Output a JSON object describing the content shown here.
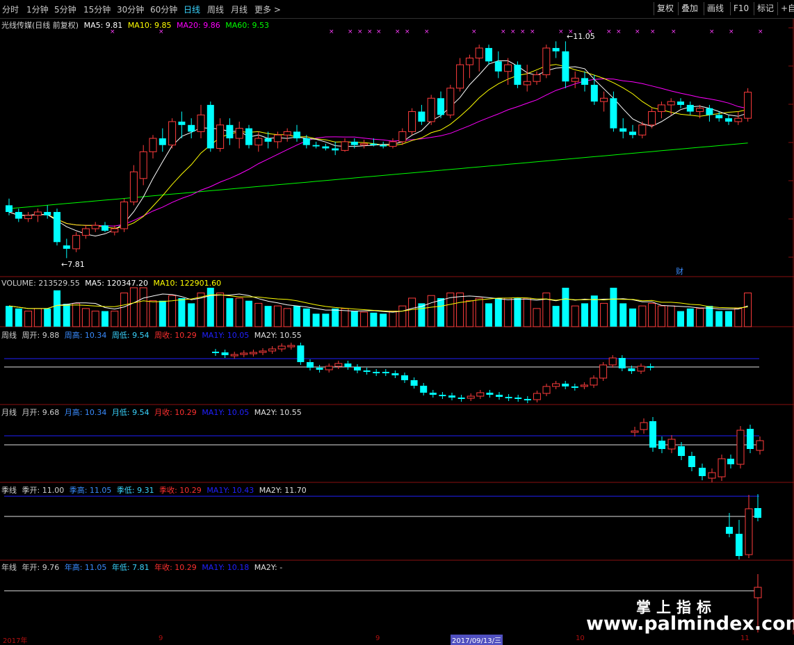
{
  "toolbar": {
    "timeframes": [
      "分时",
      "1分钟",
      "5分钟",
      "15分钟",
      "30分钟",
      "60分钟",
      "日线",
      "周线",
      "月线",
      "更多 >"
    ],
    "active_timeframe": "日线",
    "right_buttons": [
      "复权",
      "叠加",
      "画线",
      "F10",
      "标记",
      "+自选"
    ]
  },
  "main_panel": {
    "stock_title": "光线传媒(日线 前复权)",
    "ma5": "MA5: 9.81",
    "ma10": "MA10: 9.85",
    "ma20": "MA20: 9.86",
    "ma60": "MA60: 9.53",
    "high_marker": "11.05",
    "low_marker": "7.81",
    "finance_marker": "财"
  },
  "volume_panel": {
    "volume": "VOLUME: 213529.55",
    "ma5": "MA5: 120347.20",
    "ma10": "MA10: 122901.60"
  },
  "week_panel": {
    "name": "周线",
    "open": "周开: 9.88",
    "high": "周高: 10.34",
    "low": "周低: 9.54",
    "close": "周收: 10.29",
    "ma1y": "MA1Y: 10.05",
    "ma2y": "MA2Y: 10.55"
  },
  "month_panel": {
    "name": "月线",
    "open": "月开: 9.68",
    "high": "月高: 10.34",
    "low": "月低: 9.54",
    "close": "月收: 10.29",
    "ma1y": "MA1Y: 10.05",
    "ma2y": "MA2Y: 10.55"
  },
  "season_panel": {
    "name": "季线",
    "open": "季开: 11.00",
    "high": "季高: 11.05",
    "low": "季低: 9.31",
    "close": "季收: 10.29",
    "ma1y": "MA1Y: 10.43",
    "ma2y": "MA2Y: 11.70"
  },
  "year_panel": {
    "name": "年线",
    "open": "年开: 9.76",
    "high": "年高: 11.05",
    "low": "年低: 7.81",
    "close": "年收: 10.29",
    "ma1y": "MA1Y: 10.18",
    "ma2y": "MA2Y: -"
  },
  "date_axis": {
    "labels": [
      "2017年",
      "9",
      "9",
      "2017/09/13/三",
      "10",
      "11"
    ]
  },
  "watermark": {
    "cn": "掌上指标",
    "url": "www.palmindex.com"
  },
  "colors": {
    "up": "#ff3c3c",
    "down": "#00ffff",
    "ma5": "#ffffff",
    "ma10": "#ffff00",
    "ma20": "#ff00ff",
    "ma60": "#00ff00",
    "active_tab": "#3ad5ff",
    "separator": "#8a1010"
  },
  "chart_data": {
    "type": "candlestick",
    "title": "光线传媒(日线 前复权)",
    "candles_ohlc": [
      [
        8.6,
        8.7,
        8.45,
        8.5
      ],
      [
        8.5,
        8.55,
        8.35,
        8.4
      ],
      [
        8.4,
        8.5,
        8.35,
        8.45
      ],
      [
        8.45,
        8.55,
        8.35,
        8.5
      ],
      [
        8.5,
        8.6,
        8.4,
        8.45
      ],
      [
        8.5,
        8.55,
        8.0,
        8.05
      ],
      [
        8.0,
        8.1,
        7.81,
        7.95
      ],
      [
        7.95,
        8.2,
        7.9,
        8.15
      ],
      [
        8.15,
        8.3,
        8.1,
        8.25
      ],
      [
        8.25,
        8.35,
        8.2,
        8.3
      ],
      [
        8.3,
        8.35,
        8.2,
        8.22
      ],
      [
        8.2,
        8.3,
        8.15,
        8.25
      ],
      [
        8.25,
        8.7,
        8.2,
        8.65
      ],
      [
        8.65,
        9.2,
        8.6,
        9.1
      ],
      [
        9.0,
        9.5,
        8.9,
        9.4
      ],
      [
        9.4,
        9.65,
        9.3,
        9.6
      ],
      [
        9.6,
        9.75,
        9.4,
        9.5
      ],
      [
        9.5,
        9.9,
        9.45,
        9.85
      ],
      [
        9.85,
        10.0,
        9.6,
        9.8
      ],
      [
        9.8,
        9.9,
        9.6,
        9.7
      ],
      [
        9.7,
        10.1,
        9.6,
        9.95
      ],
      [
        10.1,
        10.15,
        9.4,
        9.45
      ],
      [
        9.45,
        9.9,
        9.4,
        9.8
      ],
      [
        9.8,
        9.9,
        9.5,
        9.6
      ],
      [
        9.6,
        9.85,
        9.45,
        9.75
      ],
      [
        9.75,
        9.8,
        9.45,
        9.5
      ],
      [
        9.5,
        9.7,
        9.4,
        9.6
      ],
      [
        9.6,
        9.7,
        9.45,
        9.55
      ],
      [
        9.55,
        9.7,
        9.45,
        9.65
      ],
      [
        9.65,
        9.75,
        9.55,
        9.7
      ],
      [
        9.7,
        9.8,
        9.55,
        9.6
      ],
      [
        9.6,
        9.65,
        9.45,
        9.5
      ],
      [
        9.5,
        9.55,
        9.45,
        9.48
      ],
      [
        9.48,
        9.52,
        9.42,
        9.45
      ],
      [
        9.45,
        9.55,
        9.35,
        9.42
      ],
      [
        9.42,
        9.6,
        9.4,
        9.55
      ],
      [
        9.55,
        9.6,
        9.45,
        9.5
      ],
      [
        9.5,
        9.58,
        9.45,
        9.52
      ],
      [
        9.52,
        9.6,
        9.48,
        9.5
      ],
      [
        9.5,
        9.55,
        9.45,
        9.48
      ],
      [
        9.48,
        9.6,
        9.45,
        9.55
      ],
      [
        9.55,
        9.75,
        9.5,
        9.7
      ],
      [
        9.7,
        10.05,
        9.65,
        10.0
      ],
      [
        10.0,
        10.1,
        9.8,
        9.85
      ],
      [
        9.85,
        10.25,
        9.8,
        10.2
      ],
      [
        10.2,
        10.3,
        9.9,
        9.95
      ],
      [
        9.95,
        10.4,
        9.9,
        10.35
      ],
      [
        10.35,
        10.8,
        10.3,
        10.7
      ],
      [
        10.7,
        10.85,
        10.5,
        10.8
      ],
      [
        10.8,
        11.0,
        10.6,
        10.95
      ],
      [
        10.95,
        11.0,
        10.7,
        10.75
      ],
      [
        10.75,
        10.9,
        10.5,
        10.6
      ],
      [
        10.6,
        10.8,
        10.4,
        10.7
      ],
      [
        10.7,
        10.75,
        10.35,
        10.4
      ],
      [
        10.4,
        10.7,
        10.3,
        10.45
      ],
      [
        10.45,
        10.6,
        10.4,
        10.55
      ],
      [
        10.55,
        11.0,
        10.5,
        10.95
      ],
      [
        10.95,
        11.05,
        10.8,
        10.9
      ],
      [
        10.9,
        11.05,
        10.35,
        10.45
      ],
      [
        10.45,
        10.6,
        10.35,
        10.5
      ],
      [
        10.5,
        10.6,
        10.3,
        10.4
      ],
      [
        10.4,
        10.55,
        10.1,
        10.15
      ],
      [
        10.15,
        10.3,
        10.0,
        10.2
      ],
      [
        10.2,
        10.3,
        9.7,
        9.75
      ],
      [
        9.75,
        9.9,
        9.6,
        9.7
      ],
      [
        9.7,
        9.8,
        9.6,
        9.65
      ],
      [
        9.65,
        9.85,
        9.6,
        9.8
      ],
      [
        9.8,
        10.05,
        9.75,
        10.0
      ],
      [
        10.0,
        10.15,
        9.9,
        10.1
      ],
      [
        10.1,
        10.2,
        9.95,
        10.15
      ],
      [
        10.15,
        10.2,
        10.05,
        10.1
      ],
      [
        10.1,
        10.15,
        9.95,
        10.0
      ],
      [
        10.0,
        10.1,
        9.9,
        10.05
      ],
      [
        10.05,
        10.1,
        9.85,
        9.95
      ],
      [
        9.95,
        10.0,
        9.85,
        9.9
      ],
      [
        9.9,
        9.95,
        9.8,
        9.85
      ],
      [
        9.85,
        10.0,
        9.8,
        9.9
      ],
      [
        9.9,
        10.35,
        9.85,
        10.29
      ]
    ],
    "ma5_level": 9.81,
    "ma10_level": 9.85,
    "ma20_level": 9.86,
    "ma60_level": 9.53,
    "high": 11.05,
    "low": 7.81
  }
}
